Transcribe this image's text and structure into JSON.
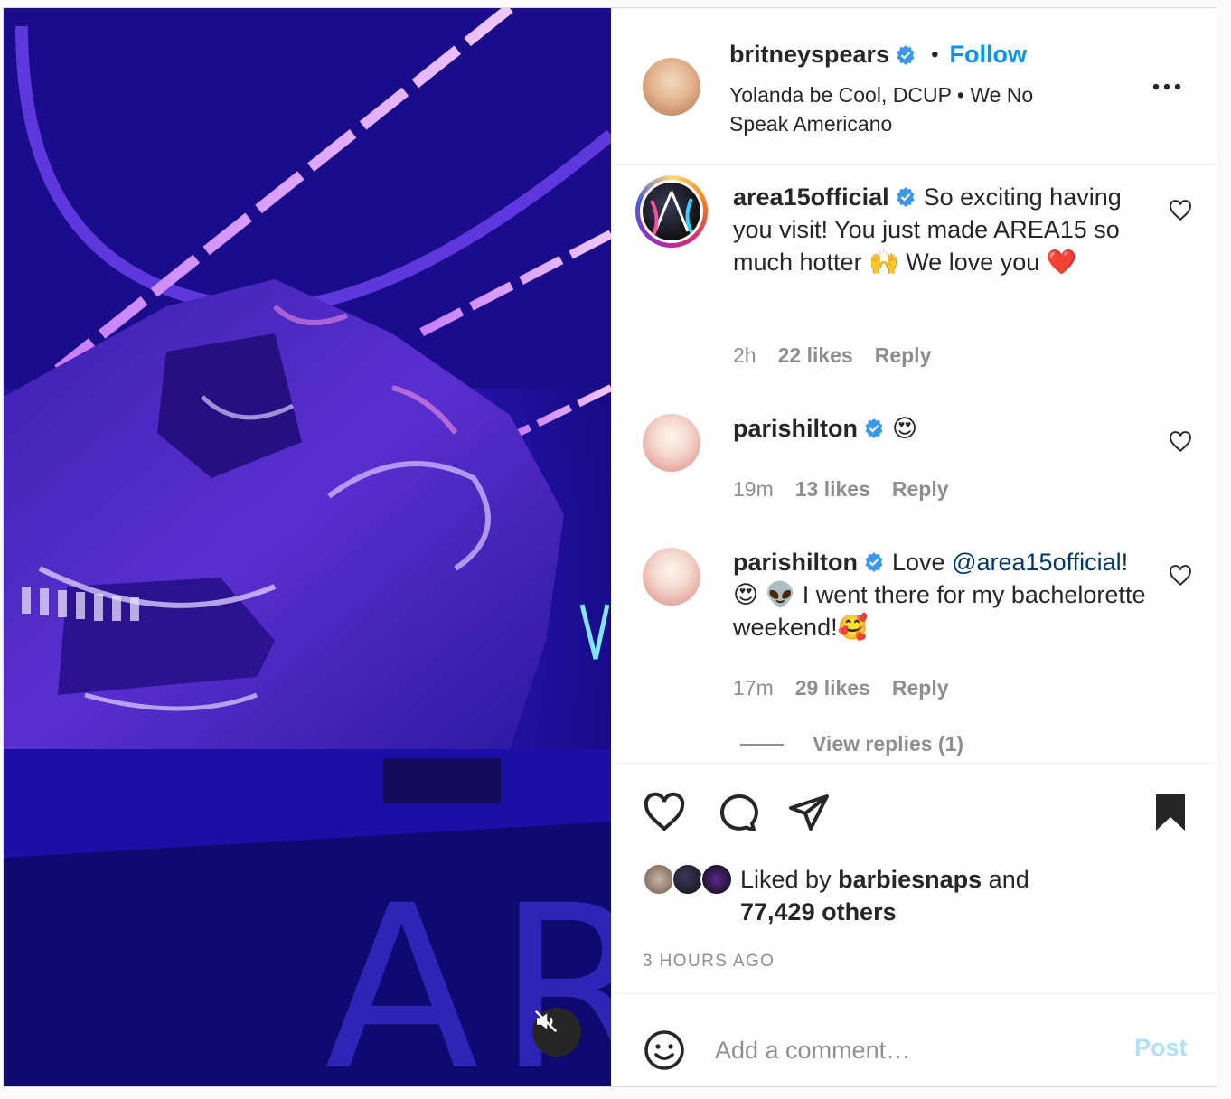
{
  "post": {
    "author": "britneyspears",
    "follow_label": "Follow",
    "separator": "•",
    "subtitle": "Yolanda be Cool, DCUP • We No Speak Americano",
    "media_watermark": "ARE"
  },
  "comments": [
    {
      "user": "area15official",
      "text_parts": [
        "So exciting having you visit! You just made AREA15 so much hotter 🙌 We love you ❤️"
      ],
      "time": "2h",
      "likes": "22 likes",
      "reply_label": "Reply"
    },
    {
      "user": "parishilton",
      "text": "😍",
      "time": "19m",
      "likes": "13 likes",
      "reply_label": "Reply"
    },
    {
      "user": "parishilton",
      "text_prefix": "Love",
      "mention": "@area15official",
      "text_suffix": "! 😍 👽 I went there for my bachelorette weekend!🥰",
      "time": "17m",
      "likes": "29 likes",
      "reply_label": "Reply",
      "view_replies": "View replies (1)"
    }
  ],
  "likes_summary": {
    "prefix": "Liked by",
    "user": "barbiesnaps",
    "middle": "and",
    "others": "77,429 others"
  },
  "timestamp": "3 HOURS AGO",
  "add_comment": {
    "placeholder": "Add a comment…",
    "post_label": "Post"
  },
  "icons": {
    "verified": "verified-badge-icon",
    "more": "more-options-icon",
    "like": "heart-icon",
    "comment": "comment-bubble-icon",
    "share": "paper-plane-icon",
    "save": "bookmark-icon",
    "emoji": "smiley-icon",
    "mute": "speaker-muted-icon"
  },
  "colors": {
    "accent": "#0095f6",
    "post_disabled": "#b2dffc",
    "verified": "#3897f0",
    "media_bg": "#2a16b8"
  }
}
